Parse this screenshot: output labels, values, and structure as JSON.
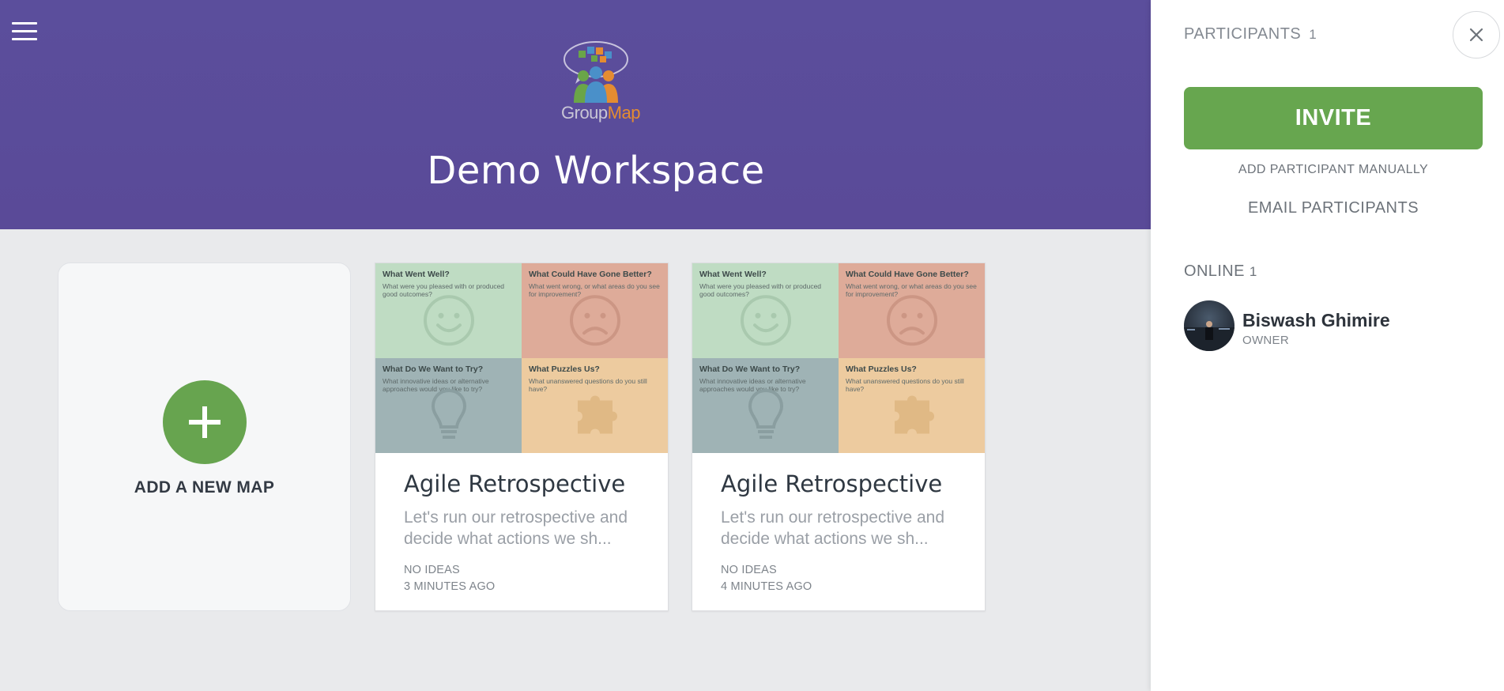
{
  "header": {
    "menu_icon": "hamburger-menu-icon",
    "logo": {
      "text_group": "Group",
      "text_map": "Map"
    },
    "workspace_title": "Demo Workspace"
  },
  "add_card": {
    "label": "ADD A NEW MAP",
    "icon": "plus-icon"
  },
  "maps": [
    {
      "title": "Agile Retrospective",
      "description_line1": "Let's run our retrospective and",
      "description_line2": "decide what actions we sh...",
      "ideas": "NO IDEAS",
      "time": "3 MINUTES AGO",
      "quadrants": [
        {
          "title": "What Went Well?",
          "desc": "What were you pleased with or produced good outcomes?",
          "icon": "smiley-icon"
        },
        {
          "title": "What Could Have Gone Better?",
          "desc": "What went wrong, or what areas do you see for improvement?",
          "icon": "sad-face-icon"
        },
        {
          "title": "What Do We Want to Try?",
          "desc": "What innovative ideas or alternative approaches would you like to try?",
          "icon": "lightbulb-icon"
        },
        {
          "title": "What Puzzles Us?",
          "desc": "What unanswered questions do you still have?",
          "icon": "puzzle-icon"
        }
      ]
    },
    {
      "title": "Agile Retrospective",
      "description_line1": "Let's run our retrospective and",
      "description_line2": "decide what actions we sh...",
      "ideas": "NO IDEAS",
      "time": "4 MINUTES AGO",
      "quadrants": [
        {
          "title": "What Went Well?",
          "desc": "What were you pleased with or produced good outcomes?",
          "icon": "smiley-icon"
        },
        {
          "title": "What Could Have Gone Better?",
          "desc": "What went wrong, or what areas do you see for improvement?",
          "icon": "sad-face-icon"
        },
        {
          "title": "What Do We Want to Try?",
          "desc": "What innovative ideas or alternative approaches would you like to try?",
          "icon": "lightbulb-icon"
        },
        {
          "title": "What Puzzles Us?",
          "desc": "What unanswered questions do you still have?",
          "icon": "puzzle-icon"
        }
      ]
    }
  ],
  "panel": {
    "participants_label": "PARTICIPANTS",
    "participants_count": "1",
    "close_icon": "close-icon",
    "invite_label": "INVITE",
    "add_manual_label": "ADD PARTICIPANT MANUALLY",
    "email_label": "EMAIL PARTICIPANTS",
    "online_label": "ONLINE",
    "online_count": "1",
    "users": [
      {
        "name": "Biswash Ghimire",
        "role": "OWNER"
      }
    ]
  },
  "colors": {
    "header_bg": "#5b4e9c",
    "accent_green": "#67a64f",
    "quad_green": "#bfdcc3",
    "quad_red": "#deab99",
    "quad_blue": "#9fb3b5",
    "quad_orange": "#edcb9f"
  }
}
